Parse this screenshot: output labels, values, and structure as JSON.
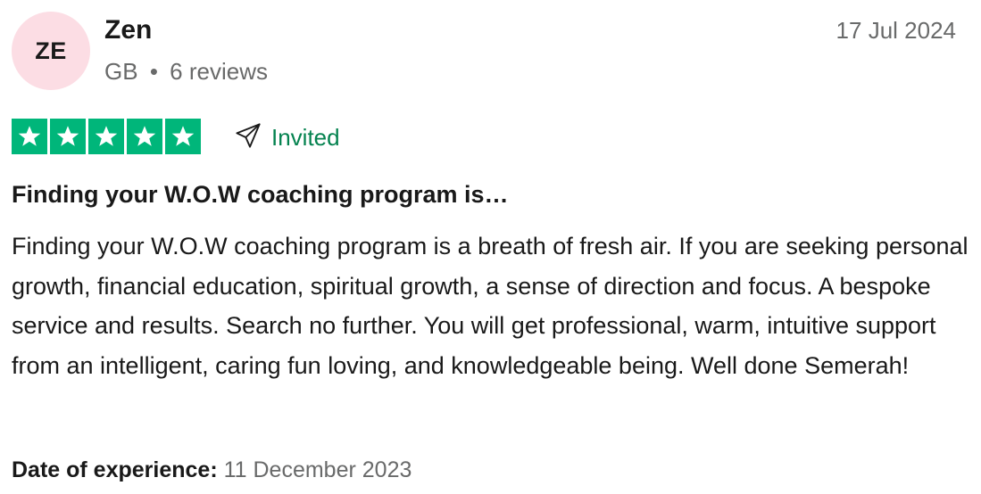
{
  "reviewer": {
    "initials": "ZE",
    "name": "Zen",
    "country": "GB",
    "separator": "•",
    "review_count": "6 reviews"
  },
  "review": {
    "date": "17 Jul 2024",
    "rating": 5,
    "max_rating": 5,
    "invited_label": "Invited",
    "title": "Finding your W.O.W coaching program is…",
    "body": "Finding your W.O.W coaching program is a breath of fresh air. If you are seeking personal growth, financial education, spiritual growth, a sense of direction and focus. A bespoke service and results. Search no further. You will get professional, warm, intuitive support from an intelligent, caring fun loving, and knowledgeable being. Well done Semerah!",
    "experience_label": "Date of experience:",
    "experience_date": "11 December 2023"
  },
  "icons": {
    "star": "star-icon",
    "invited": "paper-plane-icon"
  },
  "colors": {
    "star_background": "#00b67a",
    "invited_text": "#04824f",
    "avatar_background": "#fcdde4",
    "muted_text": "#696a6a"
  }
}
